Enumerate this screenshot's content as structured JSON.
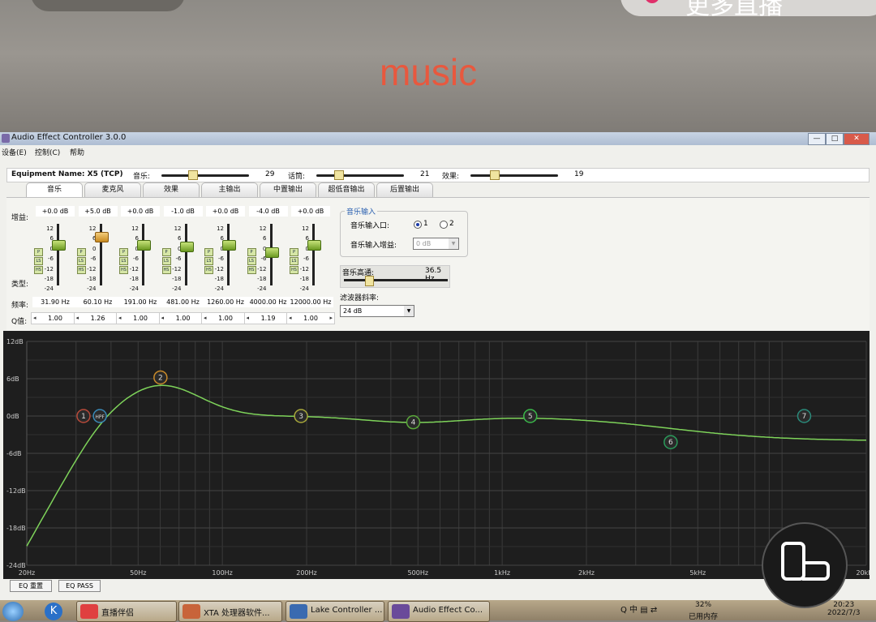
{
  "phone": {
    "right_pill_text": "更多直播",
    "music_label": "music"
  },
  "window": {
    "title": "Audio Effect Controller 3.0.0",
    "controls": [
      "—",
      "□",
      "✕"
    ],
    "menu": [
      "设备(E)",
      "控制(C)",
      "帮助"
    ]
  },
  "equip": {
    "name": "Equipment Name: X5 (TCP)",
    "sliders": [
      {
        "label": "音乐:",
        "value": "29",
        "level": 0.35
      },
      {
        "label": "话筒:",
        "value": "21",
        "level": 0.25
      },
      {
        "label": "效果:",
        "value": "19",
        "level": 0.27
      }
    ]
  },
  "tabs": [
    "音乐",
    "麦克风",
    "效果",
    "主输出",
    "中置输出",
    "超低音输出",
    "后置输出"
  ],
  "active_tab": 0,
  "labels": {
    "gain": "增益:",
    "type": "类型:",
    "freq": "频率:",
    "q": "Q值:"
  },
  "scale": [
    "12",
    "6",
    "0",
    "-6",
    "-12",
    "-18",
    "-24"
  ],
  "type_buttons": [
    "P",
    "LS",
    "HS"
  ],
  "channels": [
    {
      "gain": "+0.0 dB",
      "gain_db": 0,
      "freq": "31.90 Hz",
      "q": "1.00",
      "color": "g"
    },
    {
      "gain": "+5.0 dB",
      "gain_db": 5,
      "freq": "60.10 Hz",
      "q": "1.26",
      "color": "o"
    },
    {
      "gain": "+0.0 dB",
      "gain_db": 0,
      "freq": "191.00 Hz",
      "q": "1.00",
      "color": "g"
    },
    {
      "gain": "-1.0 dB",
      "gain_db": -1,
      "freq": "481.00 Hz",
      "q": "1.00",
      "color": "g"
    },
    {
      "gain": "+0.0 dB",
      "gain_db": 0,
      "freq": "1260.00 Hz",
      "q": "1.00",
      "color": "g"
    },
    {
      "gain": "-4.0 dB",
      "gain_db": -4,
      "freq": "4000.00 Hz",
      "q": "1.19",
      "color": "g"
    },
    {
      "gain": "+0.0 dB",
      "gain_db": 0,
      "freq": "12000.00 Hz",
      "q": "1.00",
      "color": "g"
    }
  ],
  "music_input": {
    "legend": "音乐输入",
    "port_label": "音乐输入口:",
    "port_options": [
      "1",
      "2"
    ],
    "gain_label": "音乐输入增益:",
    "gain_value": "0 dB"
  },
  "highpass": {
    "label": "音乐高通:",
    "value": "36.5 Hz"
  },
  "filter_slope": {
    "label": "滤波器斜率:",
    "value": "24 dB"
  },
  "graph": {
    "y_labels": [
      "12dB",
      "6dB",
      "0dB",
      "-6dB",
      "-12dB",
      "-18dB",
      "-24dB"
    ],
    "x_labels": [
      "20Hz",
      "50Hz",
      "100Hz",
      "200Hz",
      "500Hz",
      "1kHz",
      "2kHz",
      "5kHz",
      "10kHz",
      "20kHz"
    ],
    "markers": [
      {
        "label": "1",
        "color": "#b84a3a"
      },
      {
        "label": "HPF",
        "color": "#3a8ab8"
      },
      {
        "label": "2",
        "color": "#c88a2a"
      },
      {
        "label": "3",
        "color": "#a8a83a"
      },
      {
        "label": "4",
        "color": "#5aa83a"
      },
      {
        "label": "5",
        "color": "#3ab84a"
      },
      {
        "label": "6",
        "color": "#2a9a5a"
      },
      {
        "label": "7",
        "color": "#2a8a7a"
      }
    ],
    "curve_color": "#7ed35a"
  },
  "buttons": {
    "eq_reset": "EQ 重置",
    "eq_pass": "EQ PASS"
  },
  "taskbar": {
    "items": [
      {
        "label": "直播伴侣",
        "color": "#e04040"
      },
      {
        "label": "XTA 处理器软件...",
        "color": "#c8643a"
      },
      {
        "label": "Lake Controller ...",
        "color": "#3a6ab0"
      },
      {
        "label": "Audio Effect Co...",
        "color": "#6a4a9a"
      }
    ],
    "k_icon": "K",
    "tray_text": "Q 中 ▤ ⇄",
    "mem_percent": "32%",
    "mem_label": "已用内存",
    "time": "20:23",
    "date": "2022/7/3"
  }
}
